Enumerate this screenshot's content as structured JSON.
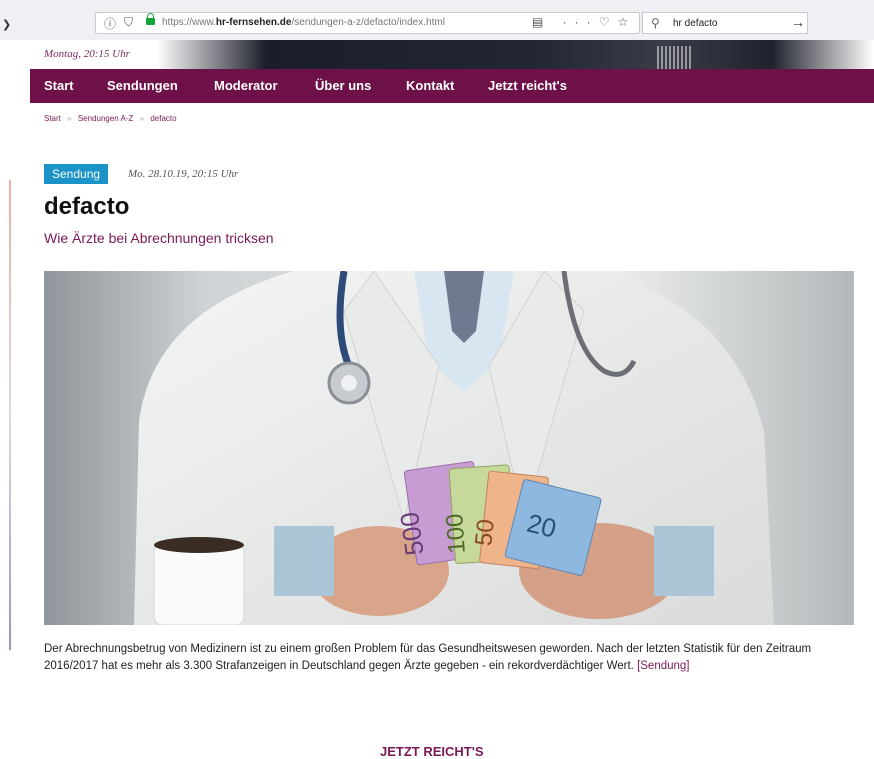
{
  "browser": {
    "url_host": "https://www.",
    "url_domain": "hr-fernsehen.de",
    "url_path": "/sendungen-a-z/defacto/index.html",
    "search_value": "hr defacto",
    "search_go": "→"
  },
  "header": {
    "date_time": "Montag, 20:15 Uhr"
  },
  "nav": {
    "items": [
      "Start",
      "Sendungen",
      "Moderator",
      "Über uns",
      "Kontakt",
      "Jetzt reicht's"
    ]
  },
  "breadcrumb": {
    "items": [
      "Start",
      "Sendungen A-Z",
      "defacto"
    ],
    "separator": "»"
  },
  "article": {
    "badge": "Sendung",
    "airdate": "Mo. 28.10.19, 20:15 Uhr",
    "title": "defacto",
    "subtitle": "Wie Ärzte bei Abrechnungen tricksen",
    "description": "Der Abrechnungsbetrug von Medizinern ist zu einem großen Problem für das Gesundheitswesen geworden. Nach der letzten Statistik für den Zeitraum 2016/2017 hat es mehr als 3.300 Strafanzeigen in Deutschland gegen Ärzte gegeben - ein rekordverdächtiger Wert.",
    "description_link": "[Sendung]",
    "banknotes": [
      "500",
      "100",
      "50",
      "20"
    ]
  },
  "next_section": {
    "heading": "JETZT REICHT'S"
  },
  "colors": {
    "brand": "#6e1148",
    "badge": "#1b92c8",
    "accent_text": "#7a1a55"
  }
}
